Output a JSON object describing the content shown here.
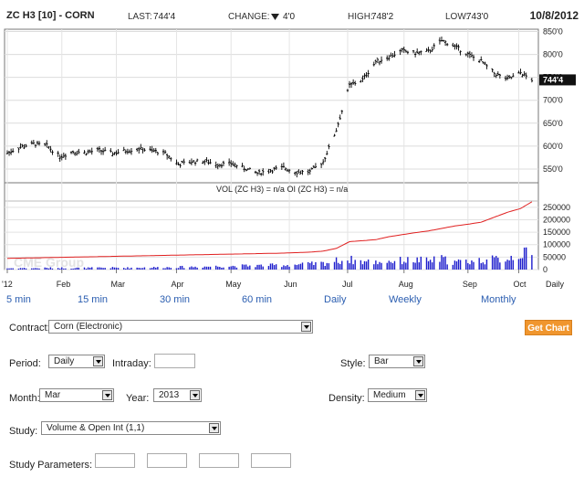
{
  "header": {
    "symbol": "ZC H3 [10] - CORN",
    "last_label": "LAST:",
    "last_value": "744'4",
    "change_label": "CHANGE:",
    "change_value": "4'0",
    "high_label": "HIGH:",
    "high_value": "748'2",
    "low_label": "LOW:",
    "low_value": "743'0",
    "date": "10/8/2012"
  },
  "chart_data": {
    "type": "line",
    "title": "ZC H3 [10] - CORN",
    "last_value_label": "744'4",
    "watermark": "CME Group",
    "price_panel": {
      "series_type": "bar",
      "y_ticks": [
        "850'0",
        "800'0",
        "750'0",
        "700'0",
        "650'0",
        "600'0",
        "550'0"
      ],
      "ylim": [
        520,
        855
      ],
      "x": [
        "2012-01-03",
        "2012-01-10",
        "2012-01-17",
        "2012-01-24",
        "2012-01-31",
        "2012-02-07",
        "2012-02-14",
        "2012-02-21",
        "2012-02-28",
        "2012-03-06",
        "2012-03-13",
        "2012-03-20",
        "2012-03-27",
        "2012-04-03",
        "2012-04-10",
        "2012-04-17",
        "2012-04-24",
        "2012-05-01",
        "2012-05-08",
        "2012-05-15",
        "2012-05-22",
        "2012-05-29",
        "2012-06-05",
        "2012-06-12",
        "2012-06-19",
        "2012-06-26",
        "2012-07-03",
        "2012-07-10",
        "2012-07-17",
        "2012-07-24",
        "2012-07-31",
        "2012-08-07",
        "2012-08-14",
        "2012-08-21",
        "2012-08-28",
        "2012-09-04",
        "2012-09-11",
        "2012-09-18",
        "2012-09-25",
        "2012-10-02",
        "2012-10-08"
      ],
      "close": [
        585,
        598,
        605,
        601,
        577,
        588,
        586,
        591,
        584,
        590,
        594,
        590,
        584,
        560,
        566,
        567,
        560,
        562,
        552,
        541,
        547,
        553,
        543,
        544,
        566,
        635,
        732,
        745,
        784,
        795,
        808,
        803,
        806,
        830,
        818,
        800,
        785,
        759,
        745,
        760,
        744.5
      ]
    },
    "volume_panel": {
      "title": "VOL (ZC H3) = n/a OI (ZC H3) = n/a",
      "y_ticks": [
        "250000",
        "200000",
        "150000",
        "100000",
        "50000",
        "0"
      ],
      "ylim": [
        0,
        275000
      ],
      "series": [
        {
          "name": "VOL (ZC H3)",
          "type": "bar",
          "values": [
            5000,
            6000,
            5500,
            6500,
            7000,
            6000,
            6500,
            7000,
            7500,
            7000,
            8000,
            8500,
            9000,
            10000,
            11000,
            12000,
            13000,
            14000,
            15000,
            16000,
            17000,
            18000,
            20000,
            22000,
            25000,
            35000,
            40000,
            32000,
            30000,
            34000,
            36000,
            38000,
            35000,
            42000,
            30000,
            33000,
            37000,
            40000,
            45000,
            65000,
            60000
          ]
        },
        {
          "name": "OI (ZC H3)",
          "type": "line",
          "values": [
            45000,
            46000,
            47000,
            48000,
            49000,
            50000,
            51000,
            52000,
            53000,
            54000,
            55000,
            56000,
            57000,
            58000,
            59000,
            60000,
            61000,
            62000,
            63000,
            64000,
            65000,
            66000,
            68000,
            70000,
            74000,
            85000,
            112000,
            116000,
            120000,
            132000,
            140000,
            148000,
            155000,
            165000,
            175000,
            182000,
            190000,
            210000,
            230000,
            245000,
            272000
          ]
        }
      ]
    },
    "x_ticks": [
      {
        "label": "'12",
        "date": "2012-01-03"
      },
      {
        "label": "Feb",
        "date": "2012-02-01"
      },
      {
        "label": "Mar",
        "date": "2012-03-01"
      },
      {
        "label": "Apr",
        "date": "2012-04-02"
      },
      {
        "label": "May",
        "date": "2012-05-01"
      },
      {
        "label": "Jun",
        "date": "2012-06-01"
      },
      {
        "label": "Jul",
        "date": "2012-07-02"
      },
      {
        "label": "Aug",
        "date": "2012-08-01"
      },
      {
        "label": "Sep",
        "date": "2012-09-04"
      },
      {
        "label": "Oct",
        "date": "2012-10-01"
      }
    ],
    "x_period_label": "Daily",
    "colors": {
      "price": "#000000",
      "volume": "#1c1ccc",
      "open_interest": "#e02020",
      "grid": "#cccccc"
    }
  },
  "timeframes": [
    "5 min",
    "15 min",
    "30 min",
    "60 min",
    "Daily",
    "Weekly",
    "Monthly"
  ],
  "form": {
    "contract_label": "Contract:",
    "contract_value": "Corn (Electronic)",
    "get_chart_label": "Get Chart",
    "period_label": "Period:",
    "period_value": "Daily",
    "intraday_label": "Intraday:",
    "intraday_value": "",
    "style_label": "Style:",
    "style_value": "Bar",
    "month_label": "Month:",
    "month_value": "Mar",
    "year_label": "Year:",
    "year_value": "2013",
    "density_label": "Density:",
    "density_value": "Medium",
    "study_label": "Study:",
    "study_value": "Volume & Open Int (1,1)",
    "study_params_label": "Study Parameters:",
    "study_params": [
      "",
      "",
      "",
      ""
    ]
  }
}
